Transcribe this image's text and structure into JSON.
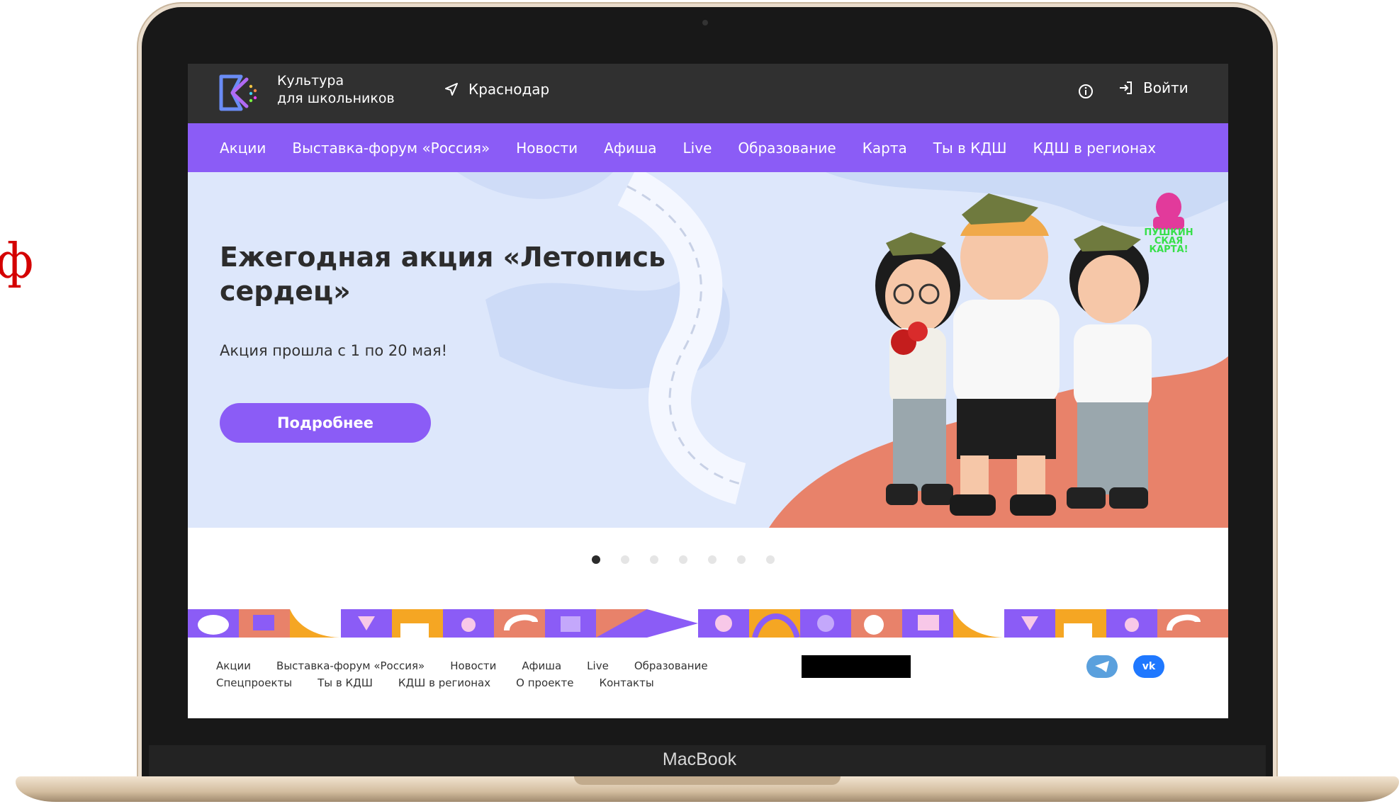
{
  "side_glyph": "ф",
  "laptop": {
    "brand": "MacBook"
  },
  "header": {
    "logo_line1": "Культура",
    "logo_line2": "для школьников",
    "city": "Краснодар",
    "login": "Войти"
  },
  "nav": {
    "items": [
      "Акции",
      "Выставка-форум «Россия»",
      "Новости",
      "Афиша",
      "Live",
      "Образование",
      "Карта",
      "Ты в КДШ",
      "КДШ в регионах"
    ]
  },
  "hero": {
    "title": "Ежегодная акция «Летопись сердец»",
    "subtitle": "Акция прошла с 1 по 20 мая!",
    "button": "Подробнее",
    "badge_text": "ПУШКИНСКАЯ КАРТА!",
    "badge_lines": [
      "ПУШКИН",
      "СКАЯ",
      "КАРТА!"
    ]
  },
  "carousel": {
    "total": 7,
    "active": 1
  },
  "footer": {
    "row1": [
      "Акции",
      "Выставка-форум «Россия»",
      "Новости",
      "Афиша",
      "Live",
      "Образование"
    ],
    "row2": [
      "Спецпроекты",
      "Ты в КДШ",
      "КДШ в регионах",
      "О проекте",
      "Контакты"
    ],
    "vk_label": "vk"
  },
  "colors": {
    "accent": "#8b5cf6",
    "topbar": "#303030",
    "hero_bg": "#dde7fb"
  },
  "icons": [
    "location-arrow-icon",
    "info-icon",
    "login-icon",
    "telegram-icon",
    "vk-icon"
  ]
}
